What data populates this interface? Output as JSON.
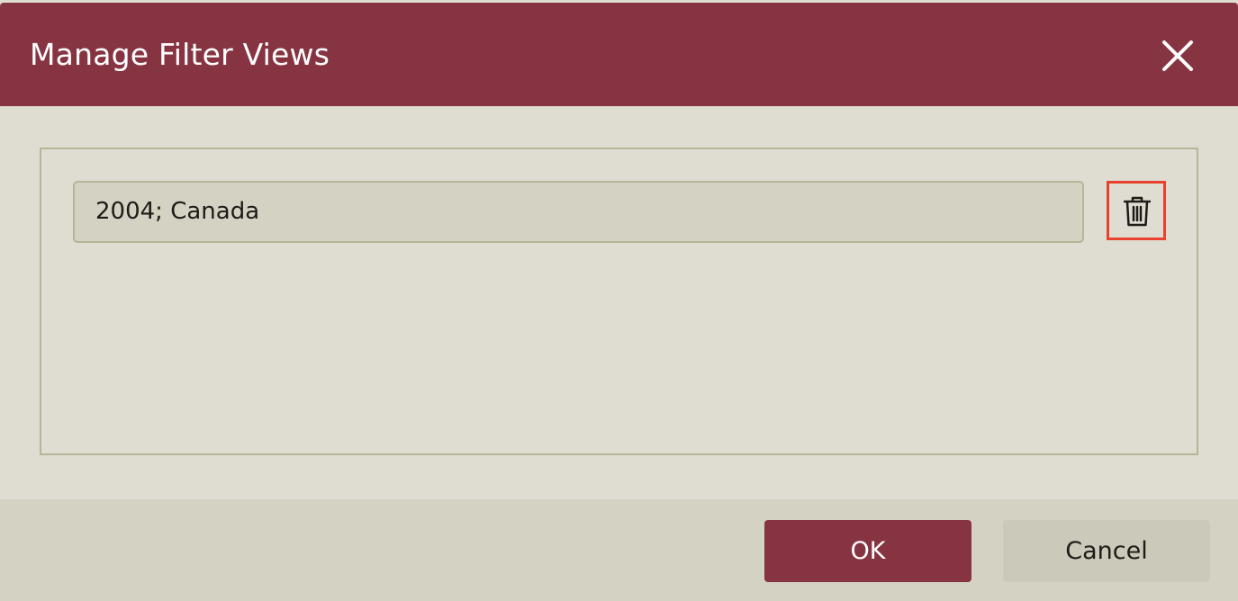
{
  "dialog": {
    "title": "Manage Filter Views",
    "close_icon": "close-icon"
  },
  "filter_views": [
    {
      "name": "2004; Canada",
      "delete_icon": "trash-icon"
    }
  ],
  "footer": {
    "ok_label": "OK",
    "cancel_label": "Cancel"
  },
  "colors": {
    "header_bg": "#873442",
    "dialog_bg": "#dfddd1",
    "footer_bg": "#d4d2c3",
    "highlight_border": "#e8412e"
  }
}
